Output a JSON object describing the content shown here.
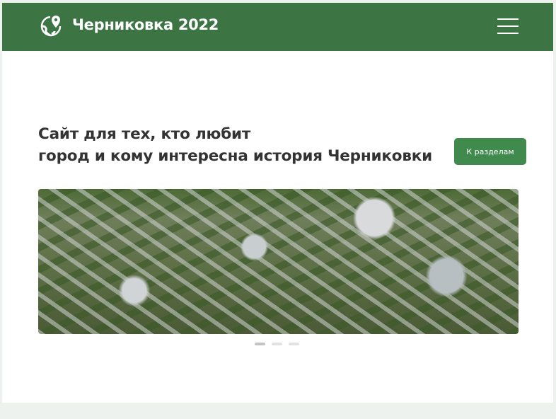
{
  "header": {
    "brand": "Черниковка 2022",
    "logo_icon": "globe-pin-icon",
    "menu_icon": "hamburger-icon",
    "color": "#3c7444"
  },
  "hero": {
    "title_line1": "Сайт для тех, кто любит",
    "title_line2": "город и кому интересна история Черниковки",
    "cta_label": "К разделам",
    "cta_color": "#3f8a4c"
  },
  "carousel": {
    "image": "aerial view of city district",
    "slides": 3,
    "active_slide": 1
  }
}
